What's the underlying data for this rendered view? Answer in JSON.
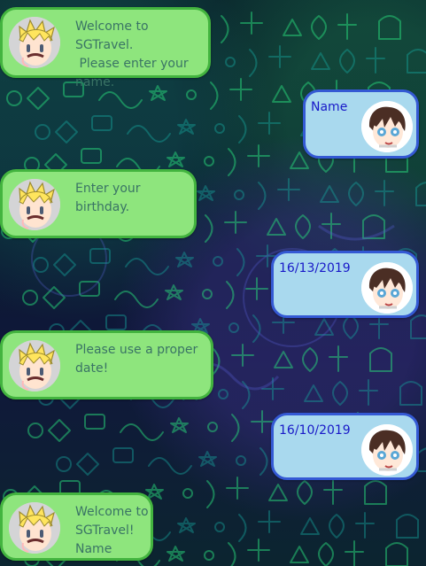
{
  "chat": {
    "messages": [
      {
        "sender": "bot",
        "text": "Welcome to SGTravel.\n Please enter your\nname."
      },
      {
        "sender": "user",
        "text": "Name"
      },
      {
        "sender": "bot",
        "text": "Enter your birthday."
      },
      {
        "sender": "user",
        "text": "16/13/2019"
      },
      {
        "sender": "bot",
        "text": "Please use a proper\ndate!"
      },
      {
        "sender": "user",
        "text": "16/10/2019"
      },
      {
        "sender": "bot",
        "text": "Welcome to\nSGTravel!\nName"
      }
    ]
  },
  "icons": {
    "bot_avatar": "blonde-worried-avatar-icon",
    "user_avatar": "brown-haired-avatar-icon"
  },
  "colors": {
    "bot_bubble": "#8ee57d",
    "bot_border": "#43b43f",
    "bot_text": "#3a7465",
    "user_bubble": "#a9d9ee",
    "user_border": "#3459d4",
    "user_text": "#1919c8",
    "wallpaper_dark": "#081d2c",
    "wallpaper_accent": "#24e36b"
  }
}
